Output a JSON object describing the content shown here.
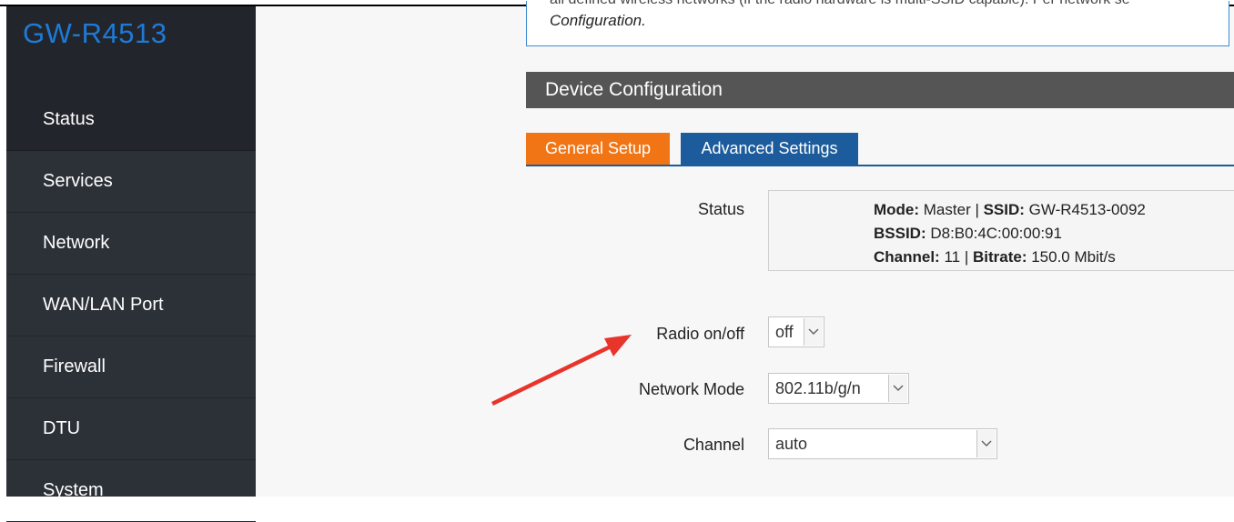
{
  "app": {
    "title": "GW-R4513"
  },
  "sidebar": {
    "items": [
      {
        "label": "Status"
      },
      {
        "label": "Services"
      },
      {
        "label": "Network"
      },
      {
        "label": "WAN/LAN Port"
      },
      {
        "label": "Firewall"
      },
      {
        "label": "DTU"
      },
      {
        "label": "System"
      }
    ]
  },
  "description": {
    "line1": "all defined wireless networks (if the radio hardware is multi-SSID capable). Per network se",
    "line2": "Configuration."
  },
  "section": {
    "title": "Device Configuration"
  },
  "tabs": [
    {
      "label": "General Setup",
      "color": "#f27515"
    },
    {
      "label": "Advanced Settings",
      "color": "#1c5c9c"
    }
  ],
  "form": {
    "status_label": "Status",
    "status": {
      "mode_key": "Mode:",
      "mode_value": " Master | ",
      "ssid_key": "SSID:",
      "ssid_value": " GW-R4513-0092",
      "bssid_key": "BSSID:",
      "bssid_value": " D8:B0:4C:00:00:91",
      "channel_key": "Channel:",
      "channel_value": " 11 | ",
      "bitrate_key": "Bitrate:",
      "bitrate_value": " 150.0 Mbit/s"
    },
    "radio_label": "Radio on/off",
    "radio_value": "off",
    "network_mode_label": "Network Mode",
    "network_mode_value": "802.11b/g/n",
    "channel_label": "Channel",
    "channel_value": "auto"
  },
  "colors": {
    "accent": "#1e7ad6",
    "annotation": "#e8352c"
  }
}
